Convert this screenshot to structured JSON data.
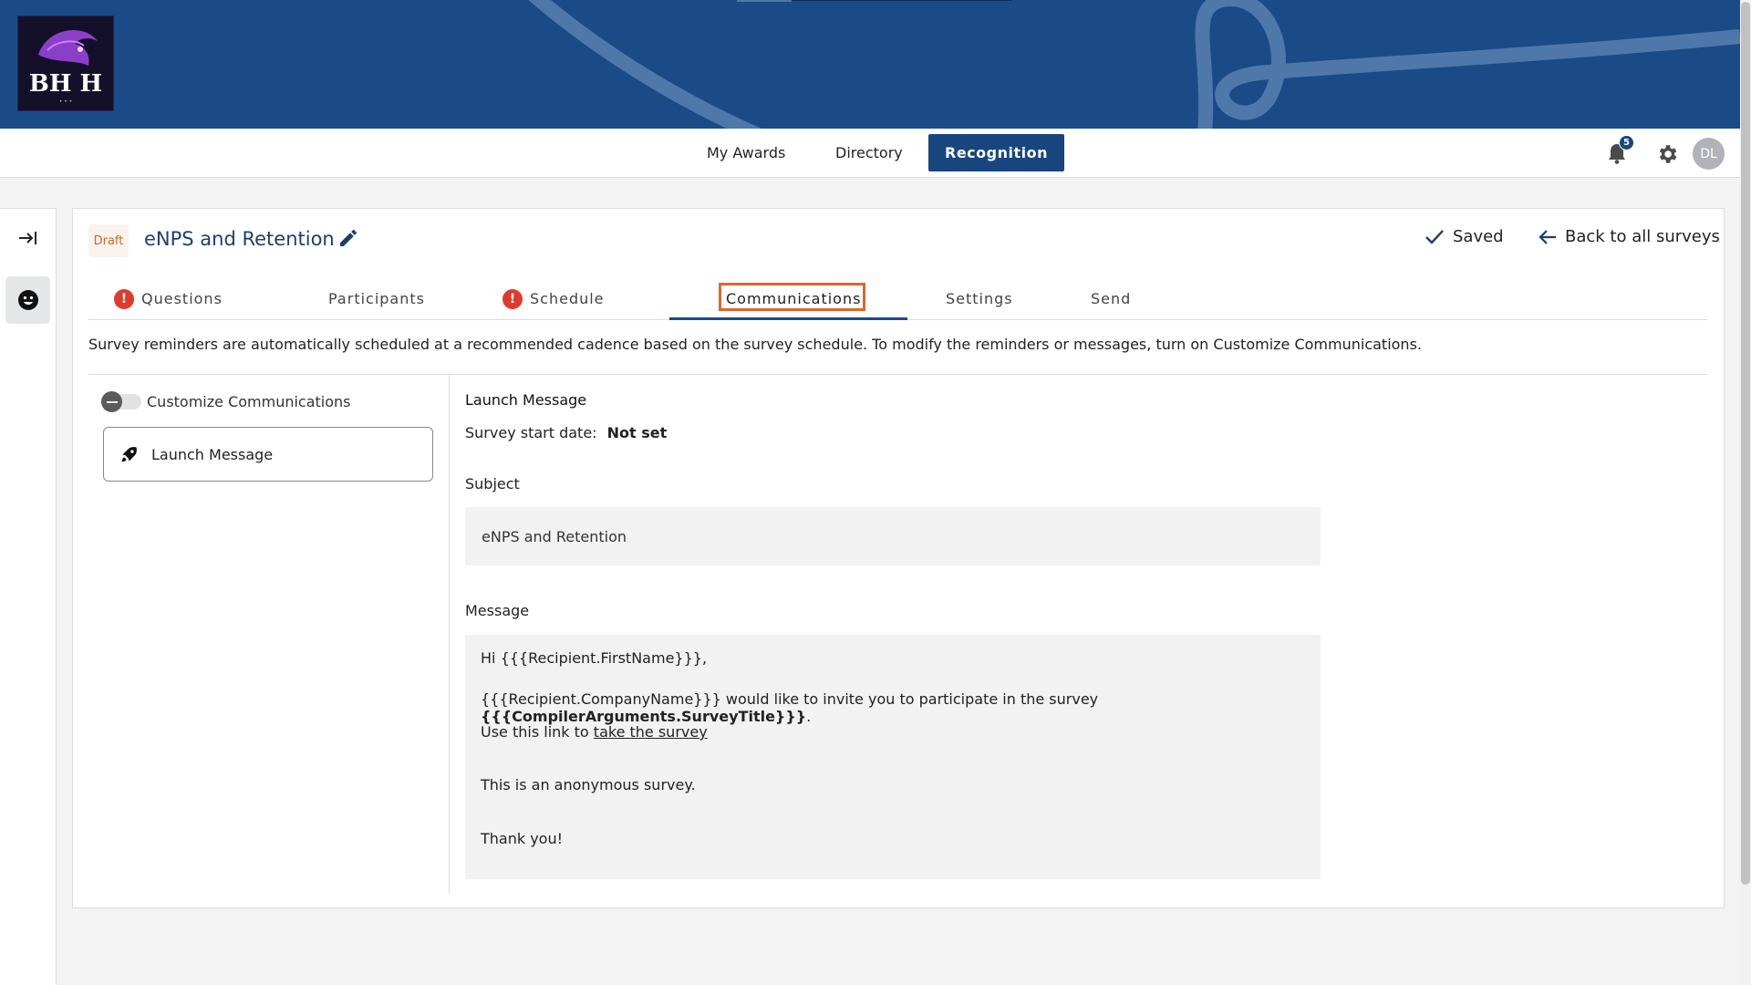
{
  "topnav": {
    "items": [
      {
        "label": "My Awards"
      },
      {
        "label": "Directory"
      },
      {
        "label": "Recognition"
      }
    ],
    "notification_count": "5",
    "avatar_initials": "DL"
  },
  "survey": {
    "status": "Draft",
    "title": "eNPS and Retention",
    "save_state": "Saved",
    "back_label": "Back to all surveys"
  },
  "tabs": [
    {
      "label": "Questions",
      "error": true
    },
    {
      "label": "Participants",
      "error": false
    },
    {
      "label": "Schedule",
      "error": true
    },
    {
      "label": "Communications",
      "error": false,
      "active": true
    },
    {
      "label": "Settings",
      "error": false
    },
    {
      "label": "Send",
      "error": false
    }
  ],
  "info_text": "Survey reminders are automatically scheduled at a recommended cadence based on the survey schedule. To modify the reminders or messages, turn on Customize Communications.",
  "sidebar": {
    "toggle_label": "Customize Communications",
    "toggle_on": false,
    "messages": [
      {
        "label": "Launch Message",
        "icon": "rocket-icon"
      }
    ]
  },
  "detail": {
    "title": "Launch Message",
    "start_date_label": "Survey start date:",
    "start_date_value": "Not set",
    "subject_label": "Subject",
    "subject_value": "eNPS and Retention",
    "message_label": "Message",
    "message": {
      "greeting": "Hi {{{Recipient.FirstName}}},",
      "invite_prefix": "{{{Recipient.CompanyName}}} would like to invite you to participate in the survey ",
      "invite_bold": "{{{CompilerArguments.SurveyTitle}}}",
      "invite_suffix": ".",
      "link_prefix": "Use this link to ",
      "link_text": "take the survey",
      "anonymous": "This is an anonymous survey.",
      "thanks": "Thank you!"
    }
  },
  "colors": {
    "brand": "#1b4b86",
    "error": "#e03a2d",
    "focus": "#e0662a"
  }
}
